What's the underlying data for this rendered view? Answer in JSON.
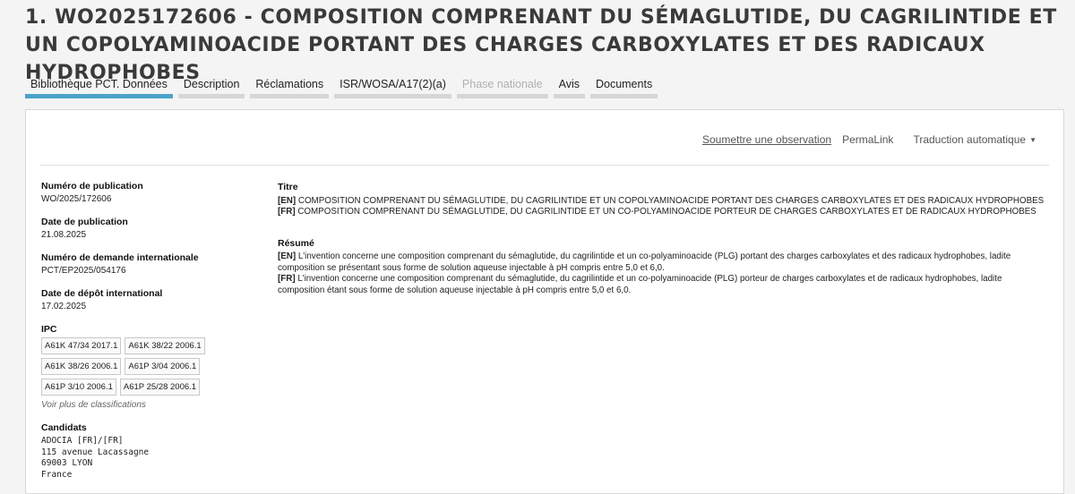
{
  "header": {
    "title": "1. WO2025172606 - COMPOSITION COMPRENANT DU SÉMAGLUTIDE, DU CAGRILINTIDE ET UN COPOLYAMINOACIDE PORTANT DES CHARGES CARBOXYLATES ET DES RADICAUX HYDROPHOBES"
  },
  "tabs": [
    {
      "label": "Bibliothèque PCT. Données",
      "state": "active"
    },
    {
      "label": "Description",
      "state": "normal"
    },
    {
      "label": "Réclamations",
      "state": "normal"
    },
    {
      "label": "ISR/WOSA/A17(2)(a)",
      "state": "normal"
    },
    {
      "label": "Phase nationale",
      "state": "disabled"
    },
    {
      "label": "Avis",
      "state": "normal"
    },
    {
      "label": "Documents",
      "state": "normal"
    }
  ],
  "toolbar": {
    "observe": "Soumettre une observation",
    "permalink": "PermaLink",
    "translate": "Traduction automatique"
  },
  "left": {
    "pub_num_label": "Numéro de publication",
    "pub_num": "WO/2025/172606",
    "pub_date_label": "Date de publication",
    "pub_date": "21.08.2025",
    "app_num_label": "Numéro de demande internationale",
    "app_num": "PCT/EP2025/054176",
    "filing_date_label": "Date de dépôt international",
    "filing_date": "17.02.2025",
    "ipc_label": "IPC",
    "ipc": [
      "A61K 47/34 2017.1",
      "A61K 38/22 2006.1",
      "A61K 38/26 2006.1",
      "A61P 3/04 2006.1",
      "A61P 3/10 2006.1",
      "A61P 25/28 2006.1"
    ],
    "more": "Voir plus de classifications",
    "applicants_label": "Candidats",
    "applicant_name": "ADOCIA [FR]/[FR]",
    "address": [
      "115 avenue Lacassagne",
      "69003 LYON",
      "France"
    ]
  },
  "right": {
    "title_label": "Titre",
    "title_en_tag": "[EN]",
    "title_en": " COMPOSITION COMPRENANT DU SÉMAGLUTIDE, DU CAGRILINTIDE ET UN COPOLYAMINOACIDE PORTANT DES CHARGES CARBOXYLATES ET DES RADICAUX HYDROPHOBES",
    "title_fr_tag": "[FR]",
    "title_fr": " COMPOSITION COMPRENANT DU SÉMAGLUTIDE, DU CAGRILINTIDE ET UN CO-POLYAMINOACIDE PORTEUR DE CHARGES CARBOXYLATES ET DE RADICAUX HYDROPHOBES",
    "abstract_label": "Résumé",
    "abstract_en_tag": "[EN]",
    "abstract_en": " L'invention concerne une composition comprenant du sémaglutide, du cagrilintide et un co-polyaminoacide (PLG) portant des charges carboxylates et des radicaux hydrophobes, ladite composition se présentant sous forme de solution aqueuse injectable à pH compris entre 5,0 et 6,0.",
    "abstract_fr_tag": "[FR]",
    "abstract_fr": " L'invention concerne une composition comprenant du sémaglutide, du cagrilintide et un co-polyaminoacide (PLG) porteur de charges carboxylates et de radicaux hydrophobes, ladite composition étant sous forme de solution aqueuse injectable à pH compris entre 5,0 et 6,0."
  }
}
